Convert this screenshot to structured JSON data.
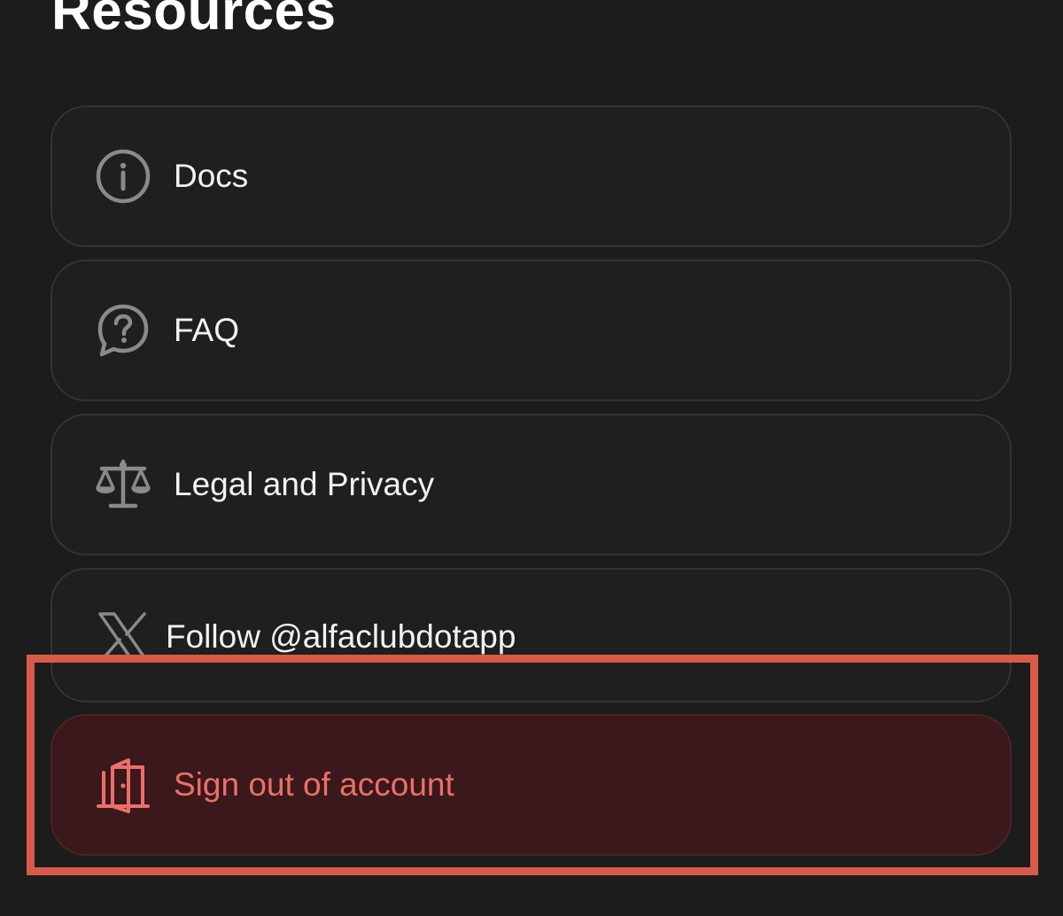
{
  "section": {
    "title": "Resources"
  },
  "items": [
    {
      "label": "Docs",
      "icon": "info-circle-icon"
    },
    {
      "label": "FAQ",
      "icon": "question-chat-icon"
    },
    {
      "label": "Legal and Privacy",
      "icon": "scales-icon"
    },
    {
      "label": "Follow @alfaclubdotapp",
      "icon": "x-logo-icon"
    },
    {
      "label": "Sign out of account",
      "icon": "door-exit-icon"
    }
  ],
  "colors": {
    "background": "#1c1c1c",
    "card": "#1f1f1f",
    "card_border": "#333333",
    "text": "#f2f2f2",
    "icon_gray": "#8a8a8a",
    "danger_bg": "#3a181b",
    "danger_text": "#ec6f6a",
    "highlight": "#d95a48"
  }
}
